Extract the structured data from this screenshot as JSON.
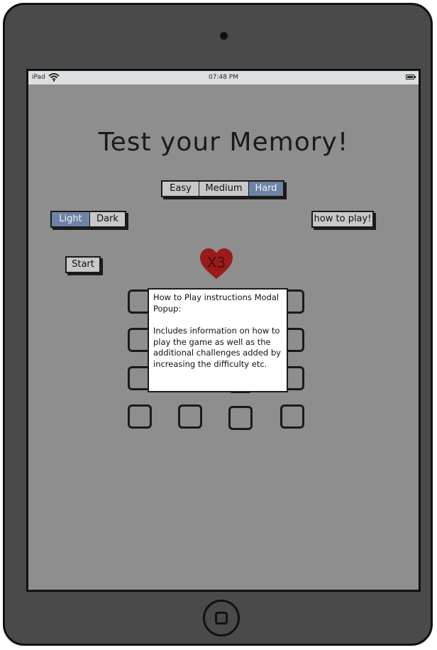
{
  "status_bar": {
    "device": "iPad",
    "time": "07:48 PM",
    "wifi_icon": "wifi-icon",
    "battery_icon": "battery-icon"
  },
  "title": "Test your Memory!",
  "difficulty": {
    "options": [
      "Easy",
      "Medium",
      "Hard"
    ],
    "selected": "Hard"
  },
  "theme": {
    "options": [
      "Light",
      "Dark"
    ],
    "selected": "Light"
  },
  "how_to_play_label": "how to play!",
  "start_label": "Start",
  "lives": {
    "label": "X3",
    "icon": "heart-icon",
    "color": "#9b1b1b"
  },
  "modal": {
    "title": "How to Play instructions Modal Popup:",
    "body": "Includes information on how to play the game as well as the additional challenges added by increasing the difficulty etc."
  },
  "colors": {
    "screen_bg": "#8e8e8e",
    "selected_segment": "#6f83a7",
    "device_body": "#4a4a4a"
  }
}
